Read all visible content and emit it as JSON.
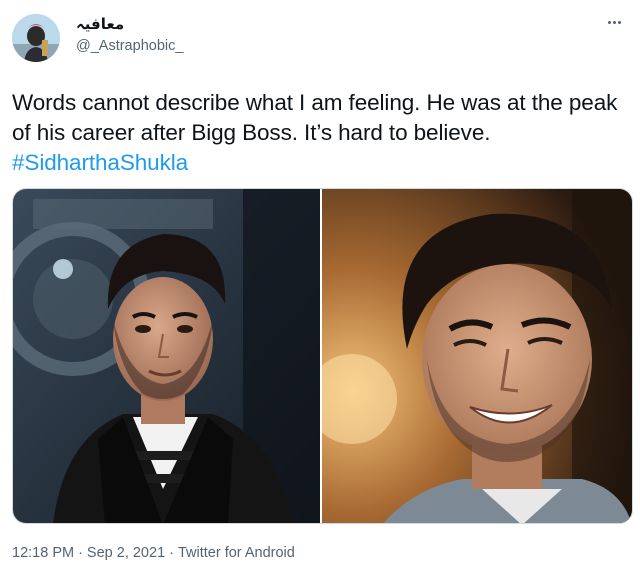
{
  "user": {
    "display_name": "معافیہ",
    "handle": "@_Astraphobic_"
  },
  "tweet": {
    "text_before_hashtag": "Words cannot describe what I am feeling. He was at the peak of his career after Bigg Boss. It’s hard to believe.",
    "hashtag": "#SidharthaShukla"
  },
  "media": {
    "photos": [
      {
        "description": "Man with styled dark hair and stubble wearing a black blazer over a striped shirt, in a studio set"
      },
      {
        "description": "Close-up of a smiling man with styled dark hair and stubble in warm indoor lighting"
      }
    ]
  },
  "meta": {
    "time": "12:18 PM",
    "separator1": "·",
    "date": "Sep 2, 2021",
    "separator2": "·",
    "source": "Twitter for Android"
  },
  "icons": {
    "more": "more-horizontal-icon"
  }
}
